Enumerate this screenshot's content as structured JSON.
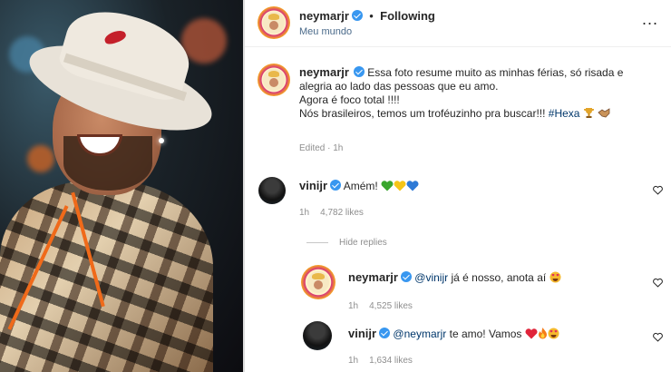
{
  "header": {
    "username": "neymarjr",
    "separator": "•",
    "follow_status": "Following",
    "location": "Meu mundo",
    "more": "..."
  },
  "caption": {
    "username": "neymarjr",
    "line1": "Essa foto resume muito as minhas férias, só risada e",
    "line2": "alegria ao lado das pessoas que eu amo.",
    "line3": "Agora é foco total !!!!",
    "line4_text": "Nós brasileiros, temos um troféuzinho pra buscar!!! ",
    "hashtag": "#Hexa",
    "meta": "Edited · 1h"
  },
  "comments": [
    {
      "username": "vinijr",
      "text": "Amém!",
      "time": "1h",
      "likes": "4,782 likes"
    }
  ],
  "hide_replies": "Hide replies",
  "replies": [
    {
      "username": "neymarjr",
      "mention": "@vinijr",
      "text": " já é nosso, anota aí",
      "time": "1h",
      "likes": "4,525 likes"
    },
    {
      "username": "vinijr",
      "mention": "@neymarjr",
      "text": " te amo! Vamos",
      "time": "1h",
      "likes": "1,634 likes"
    }
  ],
  "icons": {
    "verified": "verified-badge-icon",
    "heart": "heart-outline-icon",
    "more": "more-options-icon"
  },
  "colors": {
    "verified_blue": "#3897f0",
    "link_blue": "#00376b",
    "meta_gray": "#8e8e8e"
  }
}
